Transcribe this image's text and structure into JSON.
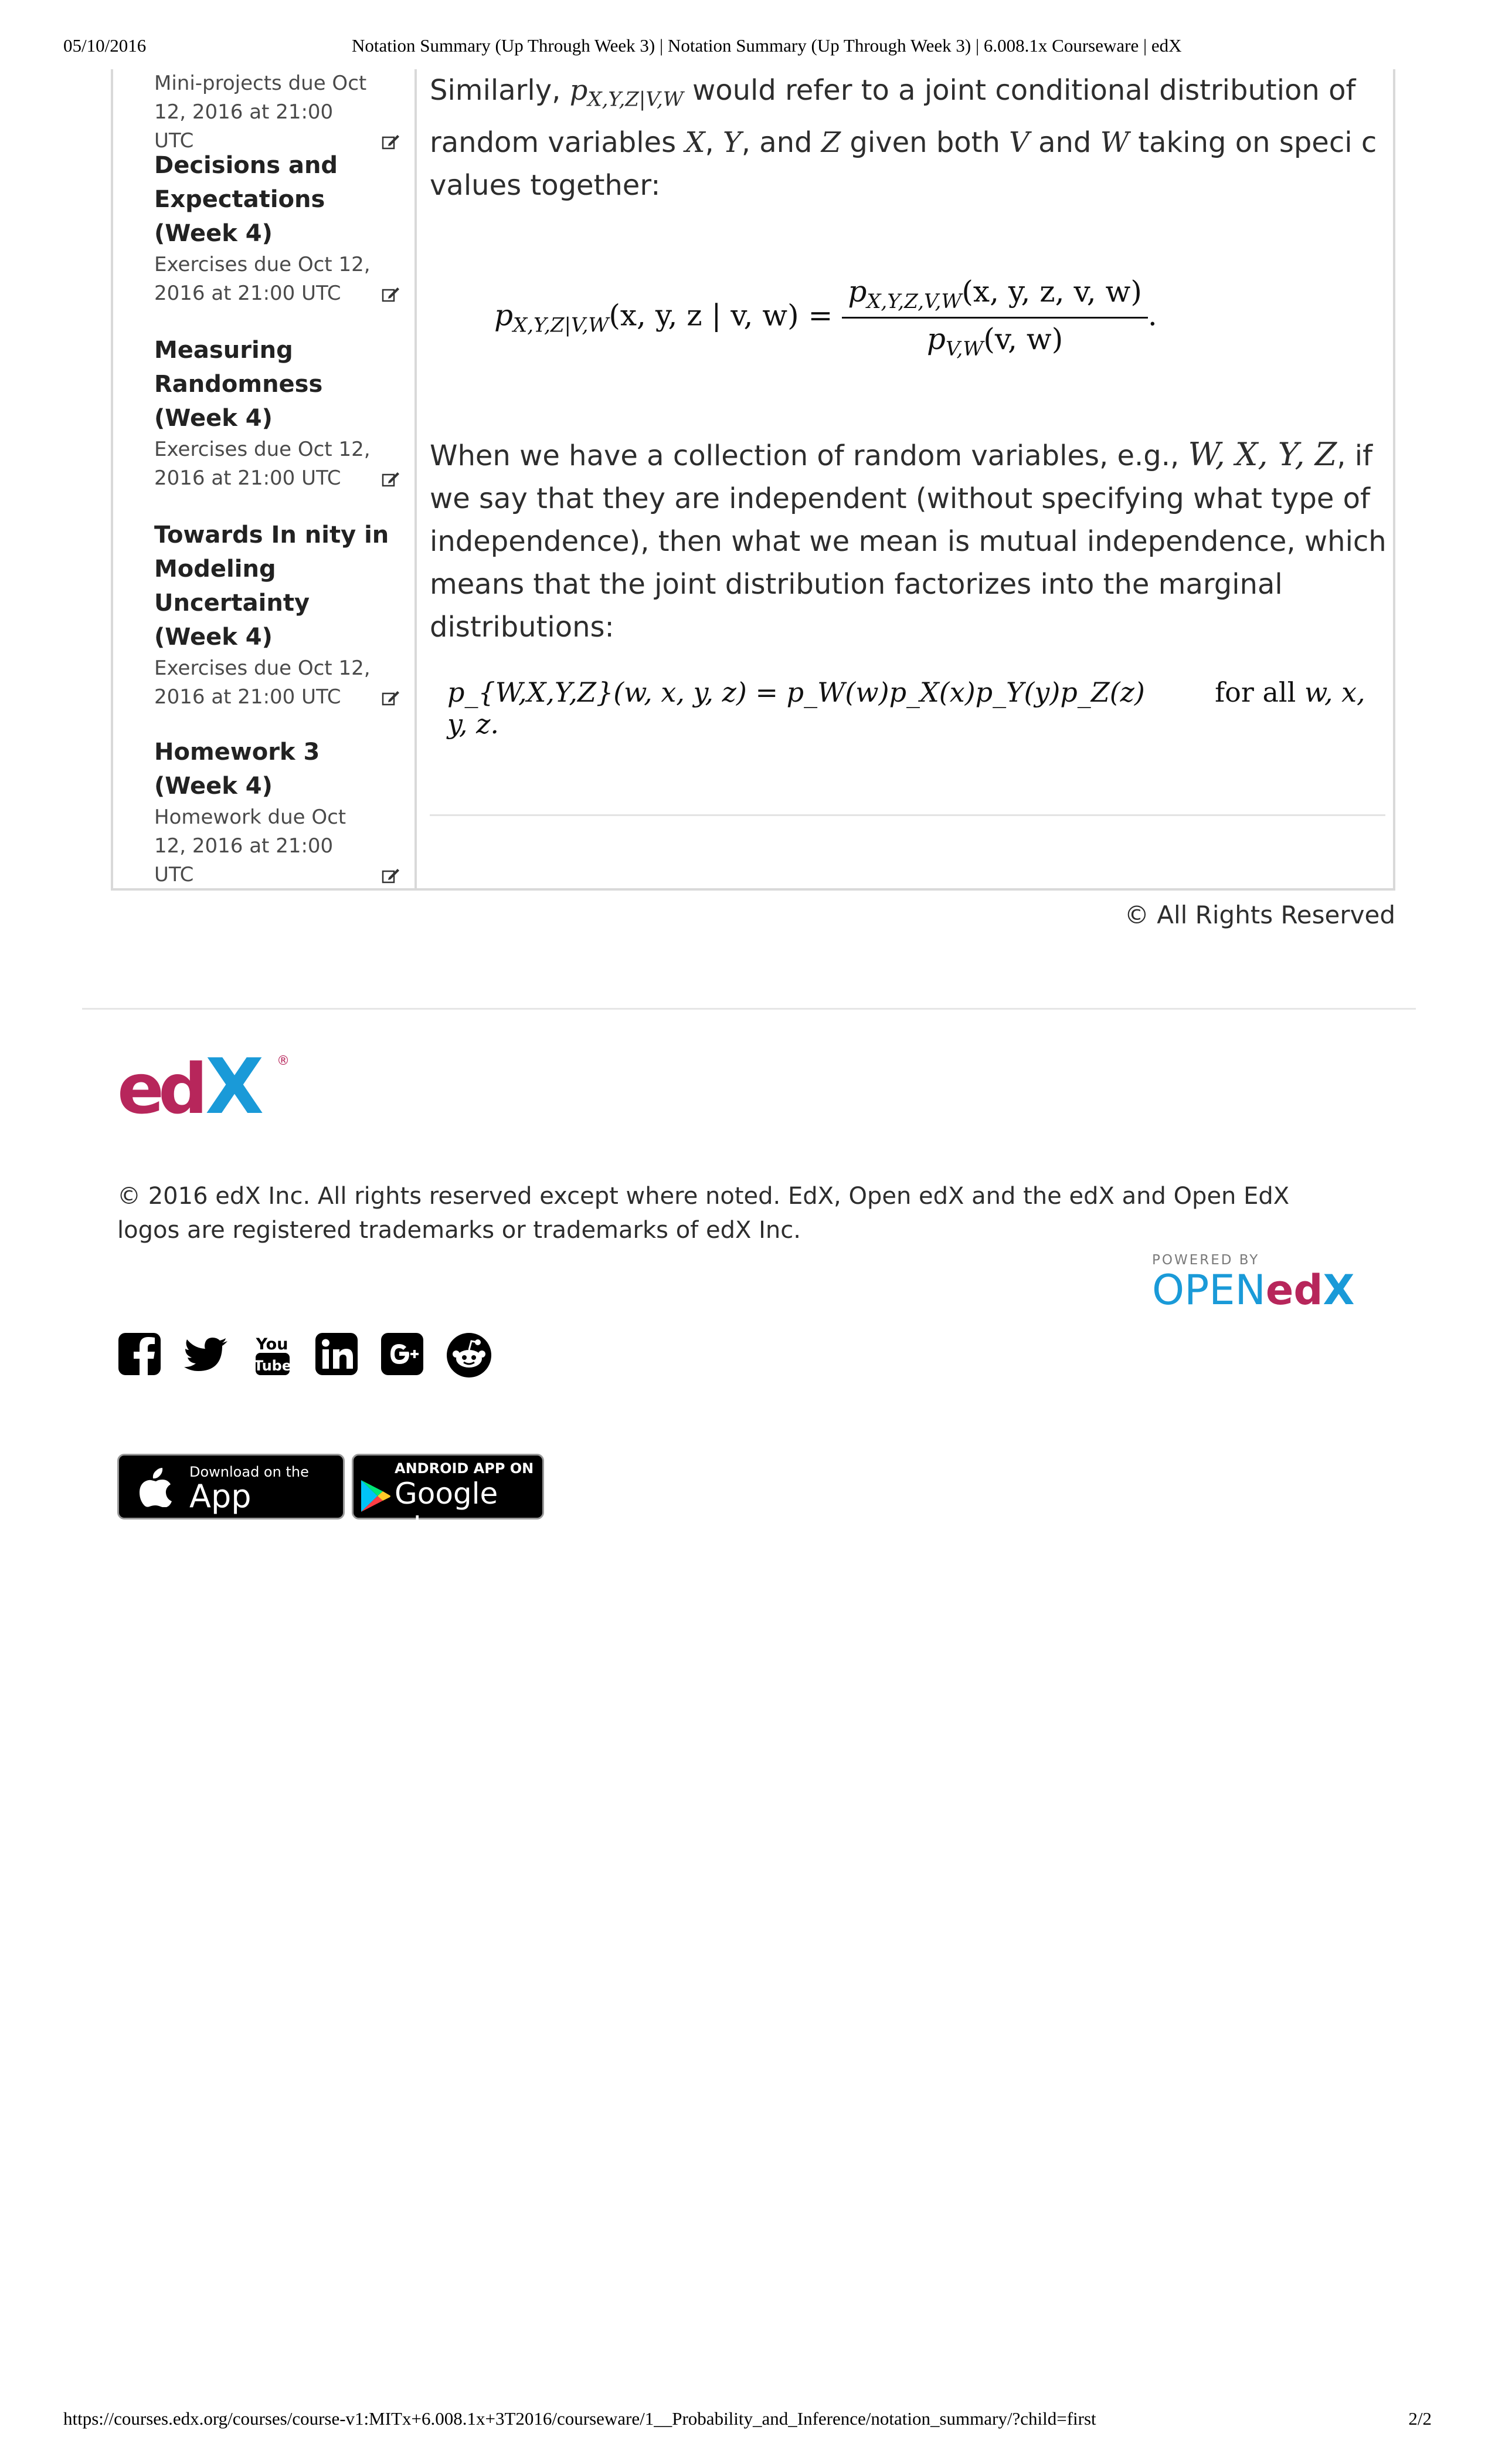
{
  "print_header": {
    "date": "05/10/2016",
    "title": "Notation Summary (Up Through Week 3) | Notation Summary (Up Through Week 3) | 6.008.1x Courseware | edX"
  },
  "print_footer": {
    "url": "https://courses.edx.org/courses/course-v1:MITx+6.008.1x+3T2016/courseware/1__Probability_and_Inference/notation_summary/?child=first",
    "page": "2/2"
  },
  "sidebar": {
    "items": [
      {
        "title": "",
        "due": "Mini-projects due Oct 12, 2016 at 21:00 UTC"
      },
      {
        "title": "Decisions and Expectations (Week 4)",
        "due": "Exercises due Oct 12, 2016 at 21:00 UTC"
      },
      {
        "title": "Measuring Randomness (Week 4)",
        "due": "Exercises due Oct 12, 2016 at 21:00 UTC"
      },
      {
        "title": "Towards In   nity in Modeling Uncertainty (Week 4)",
        "due": "Exercises due Oct 12, 2016 at 21:00 UTC"
      },
      {
        "title": "Homework 3 (Week 4)",
        "due": "Homework due Oct 12, 2016 at 21:00 UTC"
      }
    ]
  },
  "content": {
    "p1_a": "Similarly, ",
    "p1_sym": "p",
    "p1_sub": "X,Y,Z|V,W",
    "p1_b": " would refer to a joint conditional distribution of random variables ",
    "p1_X": "X",
    "p1_c": ", ",
    "p1_Y": "Y",
    "p1_d": ", and ",
    "p1_Z": "Z",
    "p1_e": " given both ",
    "p1_V": "V",
    "p1_f": " and ",
    "p1_W": "W",
    "p1_g": " taking on speci   c values together:",
    "eq1_lhs": "p",
    "eq1_lhs_sub": "X,Y,Z|V,W",
    "eq1_lhs_args": "(x, y, z | v, w) =",
    "eq1_num": "p",
    "eq1_num_sub": "X,Y,Z,V,W",
    "eq1_num_args": "(x, y, z, v, w)",
    "eq1_den": "p",
    "eq1_den_sub": "V,W",
    "eq1_den_args": "(v, w)",
    "eq1_end": ".",
    "p2_a": "When we have a collection of random variables, e.g., ",
    "p2_vars": "W, X, Y, Z",
    "p2_b": ", if we say that they are independent (without specifying what type of independence), then what we mean is mutual independence, which means that the joint distribution factorizes into the marginal distributions:",
    "eq2": "p_{W,X,Y,Z}(w, x, y, z) = p_W(w)p_X(x)p_Y(y)p_Z(z)",
    "eq2_for": "for all ",
    "eq2_vars": "w, x, y, z."
  },
  "rights": "© All Rights Reserved",
  "footer": {
    "copyright": "© 2016 edX Inc. All rights reserved except where noted. EdX, Open edX and the edX and Open EdX logos are registered trademarks or trademarks of edX Inc.",
    "powered_by": "POWERED BY",
    "open_edx_open": "OPEN",
    "open_edx_ed": "ed",
    "open_edx_x": "X",
    "edx_logo": {
      "ed": "ed",
      "x": "X",
      "mark": "®"
    },
    "social_icons": [
      "facebook-icon",
      "twitter-icon",
      "youtube-icon",
      "linkedin-icon",
      "google-plus-icon",
      "reddit-icon"
    ],
    "youtube_top": "You",
    "youtube_bottom": "Tube",
    "app_store": {
      "small": "Download on the",
      "big": "App Store"
    },
    "google_play": {
      "small": "ANDROID APP ON",
      "big": "Google play"
    }
  },
  "colors": {
    "edx_magenta": "#b7265b",
    "edx_blue": "#1a9ad8",
    "edx_gray": "#a7a7a7"
  }
}
